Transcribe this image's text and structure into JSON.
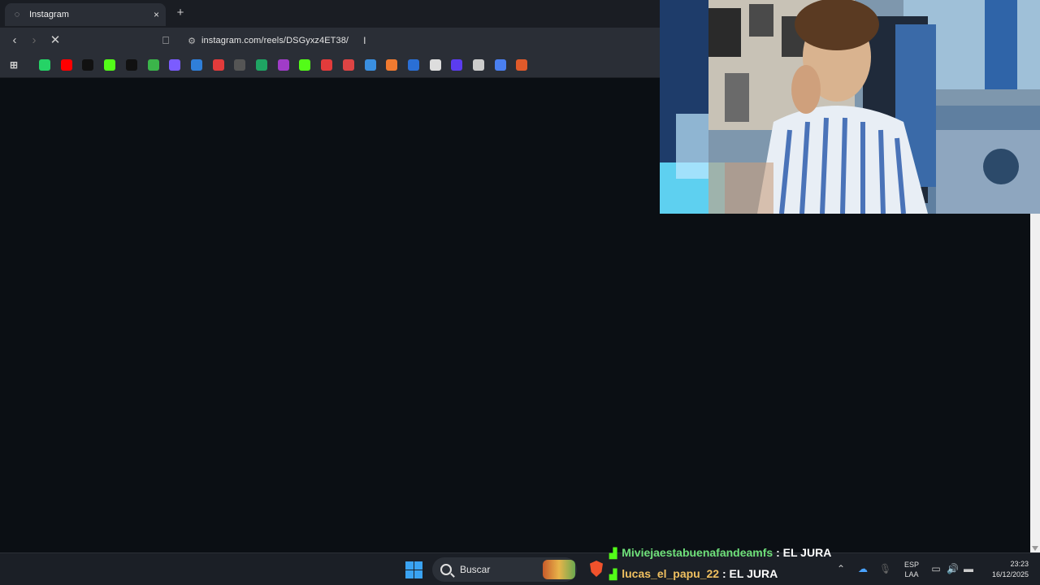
{
  "browser": {
    "tab_title": "Instagram",
    "tab_close": "×",
    "new_tab": "+",
    "url": "instagram.com/reels/DSGyxz4ET38/"
  },
  "bookmarks": [
    {
      "icon": "whatsapp-icon",
      "color": "#25d366"
    },
    {
      "icon": "youtube-icon",
      "color": "#ff0000"
    },
    {
      "icon": "tiktok-icon",
      "color": "#111111"
    },
    {
      "icon": "kick-icon",
      "color": "#53fc18"
    },
    {
      "icon": "x-icon",
      "color": "#111111"
    },
    {
      "icon": "refresh-green-icon",
      "color": "#3bb54a"
    },
    {
      "icon": "gmail-icon",
      "color": "#7b5cff"
    },
    {
      "icon": "app-blue-icon",
      "color": "#2f7fd9"
    },
    {
      "icon": "chart-red-icon",
      "color": "#e23b3b"
    },
    {
      "icon": "speed-icon",
      "color": "#555555"
    },
    {
      "icon": "sheets-icon",
      "color": "#1fa463"
    },
    {
      "icon": "purple-icon",
      "color": "#a03cc8"
    },
    {
      "icon": "kick-icon-2",
      "color": "#53fc18"
    },
    {
      "icon": "download-red-icon",
      "color": "#e33b3b"
    },
    {
      "icon": "record-icon",
      "color": "#d44"
    },
    {
      "icon": "download-blue-icon",
      "color": "#3a8fe0"
    },
    {
      "icon": "app-orange-icon",
      "color": "#f07a30"
    },
    {
      "icon": "app-blue2-icon",
      "color": "#2a6fd6"
    },
    {
      "icon": "soccer-icon",
      "color": "#dddddd"
    },
    {
      "icon": "app-indigo-icon",
      "color": "#5b3cf0"
    },
    {
      "icon": "openai-icon",
      "color": "#cccccc"
    },
    {
      "icon": "docs-icon",
      "color": "#4a7ff0"
    },
    {
      "icon": "app-red-icon",
      "color": "#e05a2a"
    }
  ],
  "taskbar": {
    "search_label": "Buscar",
    "lang_top": "ESP",
    "lang_bottom": "LAA",
    "time": "23:23",
    "date": "16/12/2025"
  },
  "chat": [
    {
      "user": "Miviejaestabuenafandeamfs",
      "user_color": "#6fe07a",
      "message": "EL JURA"
    },
    {
      "user": "lucas_el_papu_22",
      "user_color": "#f0c060",
      "message": "EL JURA"
    }
  ]
}
